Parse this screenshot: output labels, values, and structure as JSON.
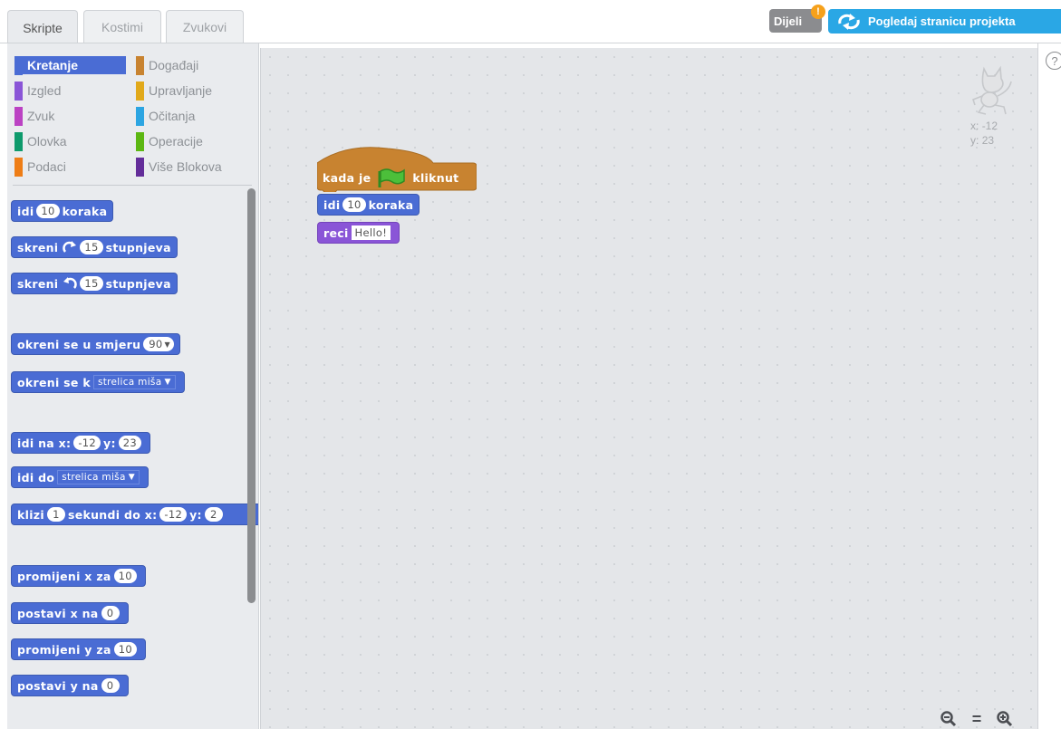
{
  "tabs": [
    {
      "label": "Skripte",
      "active": true
    },
    {
      "label": "Kostimi",
      "active": false
    },
    {
      "label": "Zvukovi",
      "active": false
    }
  ],
  "header": {
    "share_label": "Dijeli",
    "share_badge": "!",
    "project_page_label": "Pogledaj stranicu projekta"
  },
  "categories": {
    "left": [
      {
        "label": "Kretanje",
        "color": "#4a6cd4",
        "selected": true
      },
      {
        "label": "Izgled",
        "color": "#8a55d7"
      },
      {
        "label": "Zvuk",
        "color": "#bb42c3"
      },
      {
        "label": "Olovka",
        "color": "#0e9a6c"
      },
      {
        "label": "Podaci",
        "color": "#ee7d16"
      }
    ],
    "right": [
      {
        "label": "Događaji",
        "color": "#c88330"
      },
      {
        "label": "Upravljanje",
        "color": "#e1a91a"
      },
      {
        "label": "Očitanja",
        "color": "#2ca5e2"
      },
      {
        "label": "Operacije",
        "color": "#5cb712"
      },
      {
        "label": "Više Blokova",
        "color": "#632d99"
      }
    ]
  },
  "palette_blocks": {
    "move": {
      "word": "idi",
      "steps": "10",
      "unit": "koraka"
    },
    "turn_right": {
      "word": "skreni",
      "degrees": "15",
      "unit": "stupnjeva"
    },
    "turn_left": {
      "word": "skreni",
      "degrees": "15",
      "unit": "stupnjeva"
    },
    "point_dir": {
      "label": "okreni se u smjeru",
      "value": "90"
    },
    "point_towards": {
      "label": "okreni se k",
      "value": "strelica miša"
    },
    "goto_xy": {
      "label": "idi na x:",
      "x": "-12",
      "ylabel": "y:",
      "y": "23"
    },
    "goto": {
      "label": "idi do",
      "value": "strelica miša"
    },
    "glide": {
      "word": "klizi",
      "secs": "1",
      "mid": "sekundi do x:",
      "x": "-12",
      "ylabel": "y:",
      "y": "2"
    },
    "change_x": {
      "label": "promijeni x za",
      "value": "10"
    },
    "set_x": {
      "label": "postavi x na",
      "value": "0"
    },
    "change_y": {
      "label": "promijeni y za",
      "value": "10"
    },
    "set_y": {
      "label": "postavi y na",
      "value": "0"
    }
  },
  "script": {
    "hat": {
      "before": "kada je",
      "after": "kliknut"
    },
    "move": {
      "word": "idi",
      "steps": "10",
      "unit": "koraka"
    },
    "say": {
      "word": "reci",
      "text": "Hello!"
    }
  },
  "sprite_info": {
    "x_label": "x:",
    "x": "-12",
    "y_label": "y:",
    "y": "23"
  },
  "help": "?",
  "zoom": {
    "out": "−",
    "reset": "=",
    "in": "+"
  }
}
